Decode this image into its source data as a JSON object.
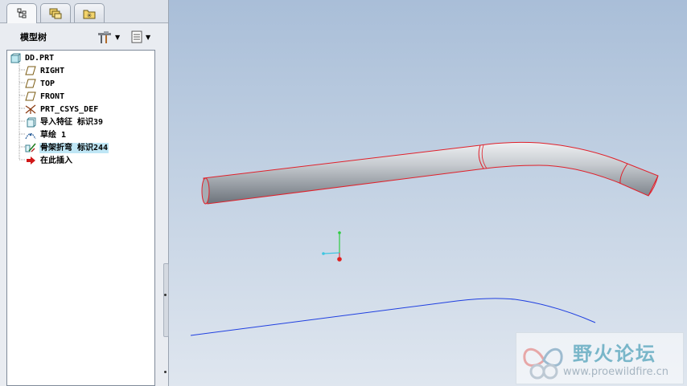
{
  "left_panel": {
    "tabs": [
      {
        "icon": "model-tree-icon",
        "active": true
      },
      {
        "icon": "layers-icon",
        "active": false
      },
      {
        "icon": "folder-star-icon",
        "active": false
      }
    ],
    "tree_title": "模型树",
    "settings_icon": "tools-icon",
    "show_icon": "list-icon",
    "tree_items": [
      {
        "label": "DD.PRT",
        "icon": "part-icon",
        "level": 0
      },
      {
        "label": "RIGHT",
        "icon": "datum-plane-icon",
        "level": 1
      },
      {
        "label": "TOP",
        "icon": "datum-plane-icon",
        "level": 1
      },
      {
        "label": "FRONT",
        "icon": "datum-plane-icon",
        "level": 1
      },
      {
        "label": "PRT_CSYS_DEF",
        "icon": "csys-icon",
        "level": 1
      },
      {
        "label": "导入特征 标识39",
        "icon": "import-feature-icon",
        "level": 1
      },
      {
        "label": "草绘 1",
        "icon": "sketch-icon",
        "level": 1
      },
      {
        "label": "骨架折弯 标识244",
        "icon": "spinal-bend-icon",
        "level": 1,
        "selected": true
      },
      {
        "label": "在此插入",
        "icon": "insert-here-arrow-icon",
        "level": 1
      }
    ]
  },
  "viewport": {
    "background_top": "#a9bed8",
    "background_bottom": "#dfe6ef",
    "model_edge_color": "#e0202a",
    "curve_color": "#1f3fe0"
  },
  "watermark": {
    "title": "野火论坛",
    "url": "www.proewildfire.cn"
  }
}
